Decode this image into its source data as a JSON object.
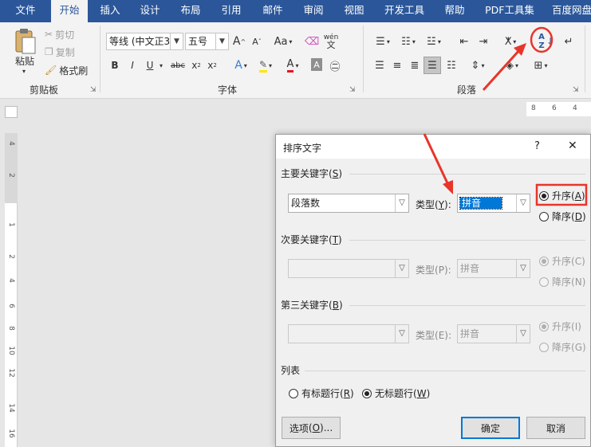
{
  "tabs": [
    {
      "label": "文件",
      "active": false
    },
    {
      "label": "开始",
      "active": true
    },
    {
      "label": "插入",
      "active": false
    },
    {
      "label": "设计",
      "active": false
    },
    {
      "label": "布局",
      "active": false
    },
    {
      "label": "引用",
      "active": false
    },
    {
      "label": "邮件",
      "active": false
    },
    {
      "label": "审阅",
      "active": false
    },
    {
      "label": "视图",
      "active": false
    },
    {
      "label": "开发工具",
      "active": false
    },
    {
      "label": "帮助",
      "active": false
    },
    {
      "label": "PDF工具集",
      "active": false
    },
    {
      "label": "百度网盘",
      "active": false
    }
  ],
  "clipboard": {
    "paste": "粘贴",
    "cut": "剪切",
    "copy": "复制",
    "format_painter": "格式刷",
    "group_label": "剪贴板"
  },
  "font": {
    "font_name": "等线 (中文正3",
    "font_size": "五号",
    "group_label": "字体",
    "grow": "A",
    "shrink": "A",
    "change_case": "Aa",
    "bold": "B",
    "italic": "I",
    "underline": "U",
    "strike": "abc",
    "subscript": "x",
    "superscript": "x",
    "text_effect": "A",
    "font_color": "A",
    "char_shading": "A",
    "pinyin": "wén"
  },
  "paragraph": {
    "group_label": "段落",
    "sort": "A↓Z",
    "align_left": "≡",
    "line_spacing": "↕"
  },
  "ruler": {
    "h_numbers": [
      "8",
      "6",
      "4"
    ],
    "v_numbers": [
      "4",
      "2",
      "1",
      "2",
      "4",
      "6",
      "8",
      "10",
      "12",
      "14",
      "16"
    ]
  },
  "dialog": {
    "title": "排序文字",
    "help": "?",
    "close": "✕",
    "primary": {
      "label": "主要关键字",
      "key": "S",
      "field": "段落数",
      "type_label": "类型",
      "type_key": "Y",
      "type_value": "拼音",
      "asc": "升序",
      "asc_key": "A",
      "desc": "降序",
      "desc_key": "D"
    },
    "secondary": {
      "label": "次要关键字",
      "key": "T",
      "field": "",
      "type_label": "类型",
      "type_key": "P",
      "type_value": "拼音",
      "asc": "升序",
      "asc_key": "C",
      "desc": "降序",
      "desc_key": "N"
    },
    "tertiary": {
      "label": "第三关键字",
      "key": "B",
      "field": "",
      "type_label": "类型",
      "type_key": "E",
      "type_value": "拼音",
      "asc": "升序",
      "asc_key": "I",
      "desc": "降序",
      "desc_key": "G"
    },
    "list": {
      "label": "列表",
      "header_row": "有标题行",
      "header_key": "R",
      "no_header_row": "无标题行",
      "no_header_key": "W"
    },
    "options_button": "选项",
    "options_key": "O",
    "ok_button": "确定",
    "cancel_button": "取消"
  },
  "colors": {
    "accent": "#2b579a",
    "highlight": "#e8352b",
    "selection": "#0078d7"
  }
}
